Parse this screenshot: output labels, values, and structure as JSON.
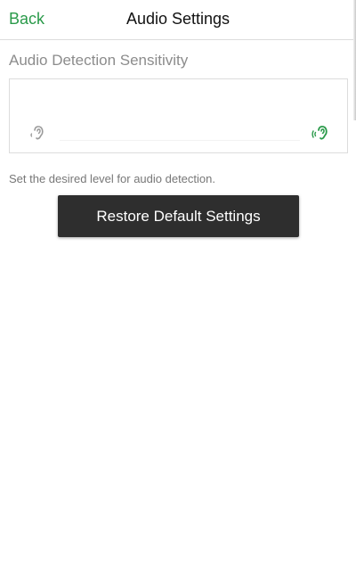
{
  "nav": {
    "back_label": "Back",
    "title": "Audio Settings"
  },
  "sensitivity": {
    "label": "Audio Detection Sensitivity",
    "low_icon": "ear-low-sound-icon",
    "high_icon": "ear-high-sound-icon",
    "helper_text": "Set the desired level for audio detection."
  },
  "actions": {
    "restore_label": "Restore Default Settings"
  },
  "colors": {
    "accent": "#2a9a4a",
    "muted_icon": "#9a9a9a",
    "button_bg": "#2e2e2e"
  }
}
